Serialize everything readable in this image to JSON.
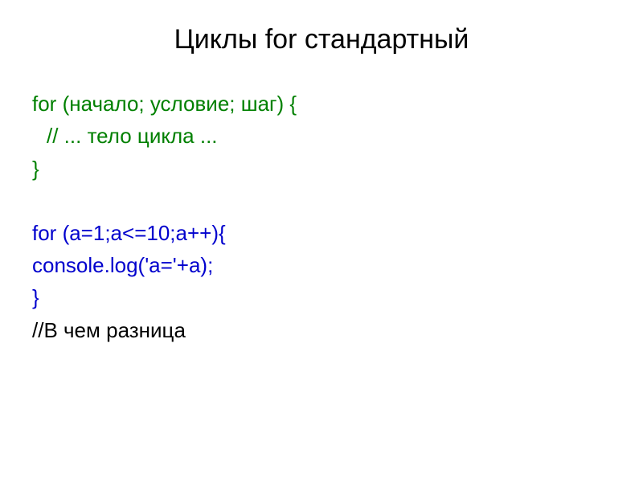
{
  "title": "Циклы for стандартный",
  "lines": {
    "l1": "for (начало; условие; шаг) {",
    "l2": "// ... тело цикла ...",
    "l3": "}",
    "l4": "for (a=1;a<=10;a++){",
    "l5": "console.log('a='+a);",
    "l6": "}",
    "l7": "//В чем разница"
  }
}
